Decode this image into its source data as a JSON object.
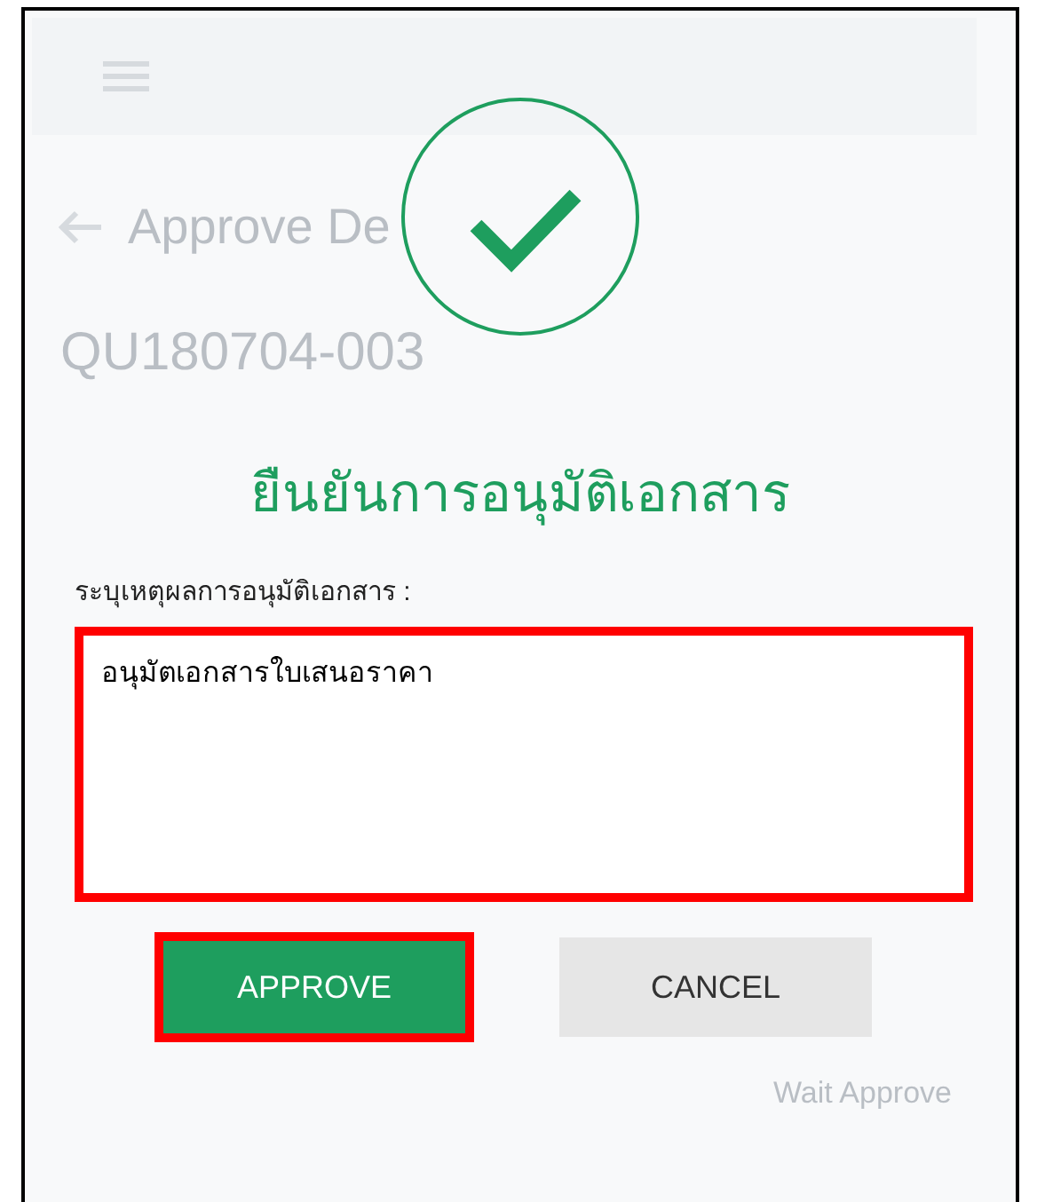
{
  "background": {
    "page_title": "Approve De",
    "document_no": "QU180704-003",
    "status": "Wait Approve"
  },
  "dialog": {
    "title": "ยืนยันการอนุมัติเอกสาร",
    "field_label": "ระบุเหตุผลการอนุมัติเอกสาร :",
    "field": {
      "value": "อนุมัตเอกสารใบเสนอราคา",
      "highlighted": true
    },
    "buttons": [
      {
        "label": "APPROVE",
        "kind": "primary",
        "highlighted": true
      },
      {
        "label": "CANCEL",
        "kind": "secondary",
        "highlighted": false
      }
    ]
  }
}
